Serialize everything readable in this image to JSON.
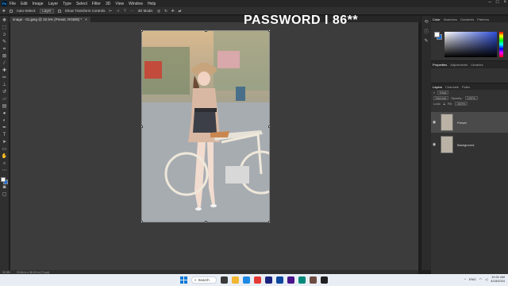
{
  "menubar": {
    "logo": "Ps",
    "items": [
      "File",
      "Edit",
      "Image",
      "Layer",
      "Type",
      "Select",
      "Filter",
      "3D",
      "View",
      "Window",
      "Help"
    ]
  },
  "options": {
    "auto_select_label": "Auto-Select:",
    "layer_value": "Layer",
    "transform_label": "Show Transform Controls",
    "mode_label": "3D Mode:"
  },
  "document_tab": {
    "label": "image - 01.jpeg @ 32.5% (Preset, RGB/8) *",
    "close": "×"
  },
  "watermark": "PASSWORD I 86**",
  "statusbar": {
    "zoom": "32.5%",
    "size": "23.84 in x 36.00 in (72 ppi)"
  },
  "panels": {
    "color_tabs": [
      "Color",
      "Swatches",
      "Gradients",
      "Patterns"
    ],
    "props_tabs": [
      "Properties",
      "Adjustments",
      "Libraries"
    ],
    "layers_tabs": [
      "Layers",
      "Channels",
      "Paths"
    ],
    "kind_label": "Kind",
    "blend_mode": "Normal",
    "opacity_label": "Opacity:",
    "opacity_value": "100%",
    "lock_label": "Lock:",
    "fill_label": "Fill:",
    "fill_value": "100%",
    "layers": [
      {
        "name": "Preset"
      },
      {
        "name": "Background"
      }
    ]
  },
  "taskbar": {
    "search_label": "Search",
    "time": "10:31 AM",
    "date": "4/18/2024",
    "lang": "ENG"
  },
  "colors": {
    "accent": "#31a8ff",
    "background_swatch": "#1a6fd8"
  }
}
